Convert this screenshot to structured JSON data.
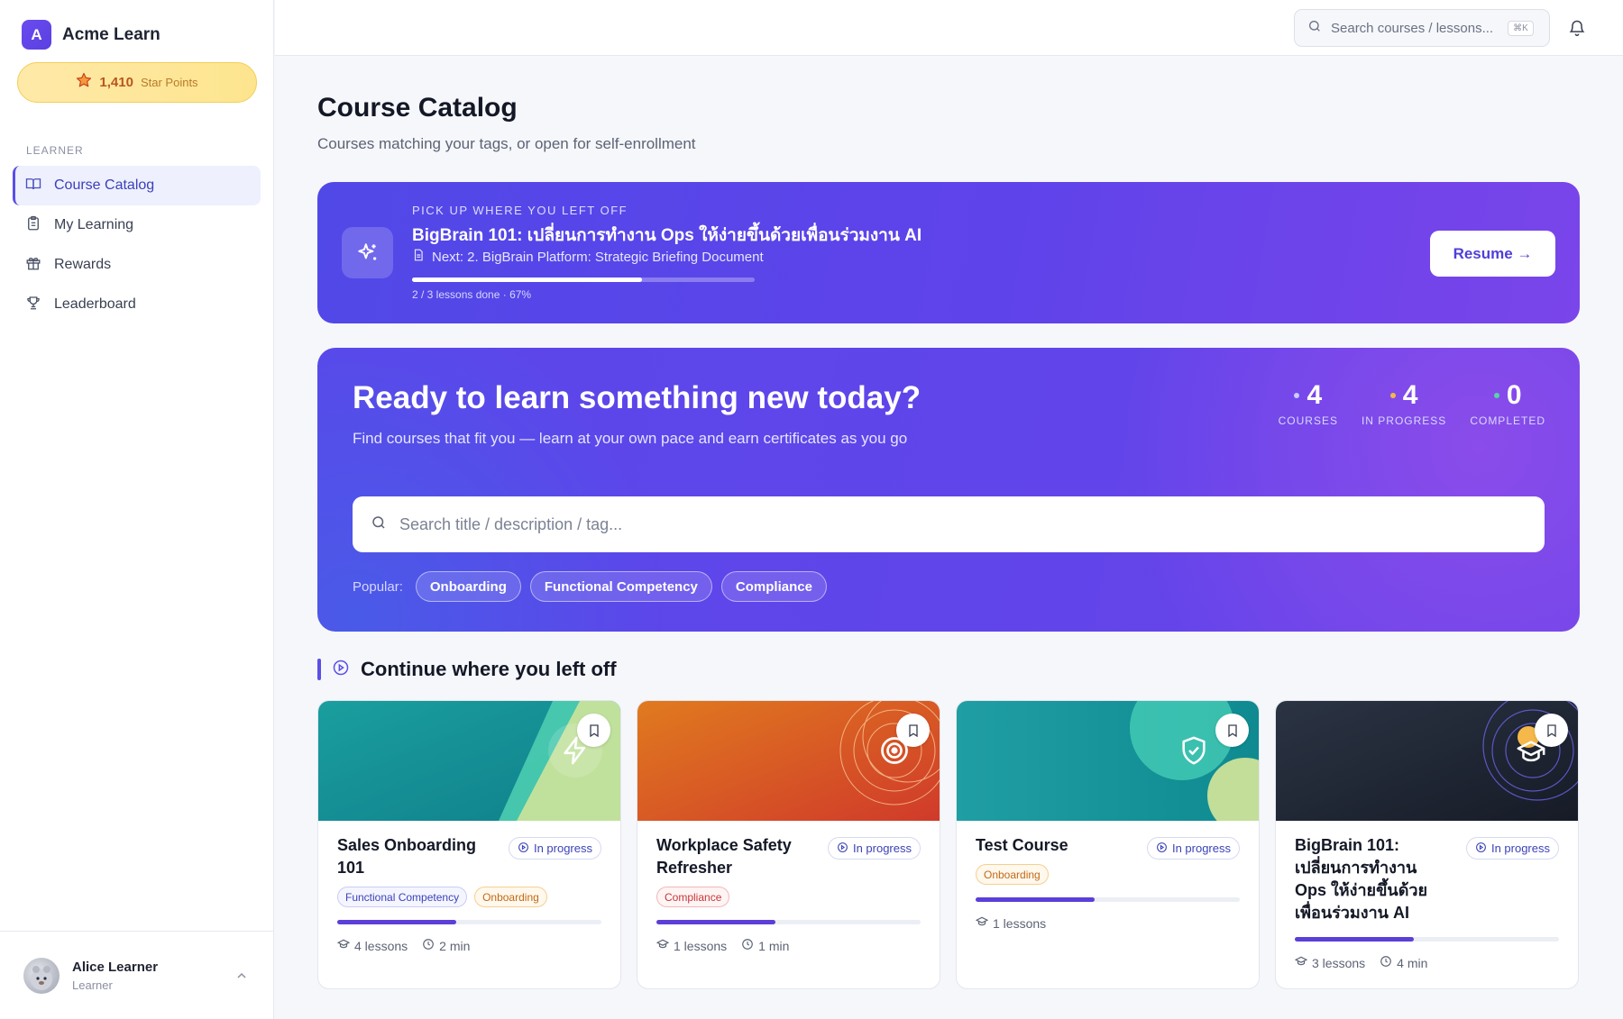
{
  "brand": {
    "logo_letter": "A",
    "name": "Acme Learn"
  },
  "points": {
    "value": "1,410",
    "label": "Star Points"
  },
  "sidebar": {
    "section_label": "LEARNER",
    "items": [
      {
        "label": "Course Catalog",
        "active": true
      },
      {
        "label": "My Learning",
        "active": false
      },
      {
        "label": "Rewards",
        "active": false
      },
      {
        "label": "Leaderboard",
        "active": false
      }
    ]
  },
  "user": {
    "name": "Alice Learner",
    "role": "Learner"
  },
  "topbar": {
    "search_placeholder": "Search courses / lessons...",
    "shortcut": "⌘K"
  },
  "page": {
    "title": "Course Catalog",
    "subtitle": "Courses matching your tags, or open for self-enrollment"
  },
  "resume": {
    "kicker": "PICK UP WHERE YOU LEFT OFF",
    "title": "BigBrain 101: เปลี่ยนการทำงาน Ops ให้ง่ายขึ้นด้วยเพื่อนร่วมงาน AI",
    "next": "Next: 2. BigBrain Platform: Strategic Briefing Document",
    "progress": 0.67,
    "meta": "2 / 3 lessons done · 67%",
    "button": "Resume →"
  },
  "hero": {
    "title": "Ready to learn something new today?",
    "subtitle": "Find courses that fit you — learn at your own pace and earn certificates as you go",
    "stats": [
      {
        "value": "4",
        "label": "COURSES",
        "color": "#c9ccff"
      },
      {
        "value": "4",
        "label": "IN PROGRESS",
        "color": "#f5b84a"
      },
      {
        "value": "0",
        "label": "COMPLETED",
        "color": "#5ad1a8"
      }
    ],
    "search_placeholder": "Search title / description / tag...",
    "popular_label": "Popular:",
    "chips": [
      "Onboarding",
      "Functional Competency",
      "Compliance"
    ]
  },
  "section": {
    "title": "Continue where you left off"
  },
  "courses": [
    {
      "title": "Sales Onboarding 101",
      "status": "In progress",
      "tags": [
        {
          "label": "Functional Competency",
          "style": "blue"
        },
        {
          "label": "Onboarding",
          "style": "orange"
        }
      ],
      "progress": 0.45,
      "lessons": "4 lessons",
      "duration": "2 min",
      "icon": "lightning-icon"
    },
    {
      "title": "Workplace Safety Refresher",
      "status": "In progress",
      "tags": [
        {
          "label": "Compliance",
          "style": "red"
        }
      ],
      "progress": 0.45,
      "lessons": "1 lessons",
      "duration": "1 min",
      "icon": "target-icon"
    },
    {
      "title": "Test Course",
      "status": "In progress",
      "tags": [
        {
          "label": "Onboarding",
          "style": "orange"
        }
      ],
      "progress": 0.45,
      "lessons": "1 lessons",
      "duration": "",
      "icon": "shield-check-icon"
    },
    {
      "title": "BigBrain 101: เปลี่ยนการทำงาน Ops ให้ง่ายขึ้นด้วยเพื่อนร่วมงาน AI",
      "status": "In progress",
      "tags": [],
      "progress": 0.45,
      "lessons": "3 lessons",
      "duration": "4 min",
      "icon": "graduation-cap-icon"
    }
  ]
}
